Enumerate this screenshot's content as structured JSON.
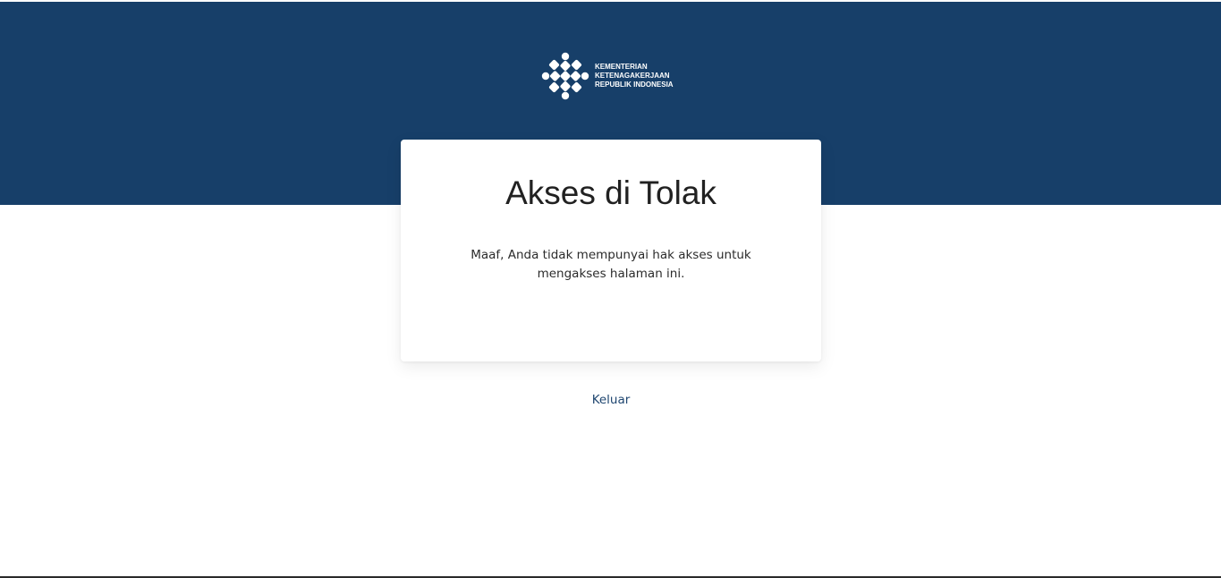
{
  "brand": {
    "logo_icon": "kemnaker-emblem-icon",
    "logo_lines": [
      "KEMENTERIAN",
      "KETENAGAKERJAAN",
      "REPUBLIK INDONESIA"
    ],
    "header_color": "#173f69"
  },
  "card": {
    "title": "Akses di Tolak",
    "message": "Maaf, Anda tidak mempunyai hak akses untuk mengakses halaman ini."
  },
  "footer": {
    "logout_label": "Keluar",
    "link_color": "#1f4670"
  }
}
